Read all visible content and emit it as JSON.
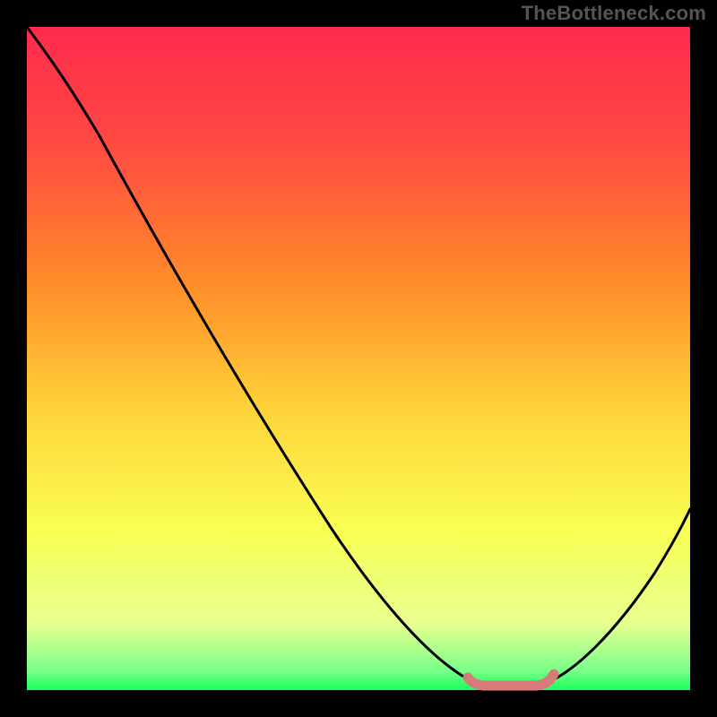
{
  "watermark": "TheBottleneck.com",
  "chart_data": {
    "type": "line",
    "title": "",
    "xlabel": "",
    "ylabel": "",
    "xlim": [
      0,
      100
    ],
    "ylim": [
      0,
      100
    ],
    "x": [
      0,
      5,
      10,
      15,
      20,
      25,
      30,
      35,
      40,
      45,
      50,
      55,
      60,
      62,
      64,
      66,
      68,
      70,
      72,
      74,
      76,
      78,
      80,
      85,
      90,
      95,
      100
    ],
    "values": [
      100,
      95,
      89,
      82,
      76,
      69,
      62,
      55,
      48,
      41,
      34,
      27,
      20,
      16,
      12,
      8,
      4,
      1,
      0,
      0,
      0,
      0,
      1,
      5,
      12,
      20,
      30
    ],
    "annotations": [
      {
        "type": "segment",
        "x_start": 70,
        "x_end": 82,
        "label": "optimal-band"
      }
    ],
    "background_gradient": {
      "top": "#ff2a4c",
      "mid_upper": "#ff8a2a",
      "mid": "#ffe63a",
      "mid_lower": "#f7ff7a",
      "bottom": "#1aff5a"
    },
    "frame_color": "#000000",
    "highlight_color": "#d97a7a"
  }
}
